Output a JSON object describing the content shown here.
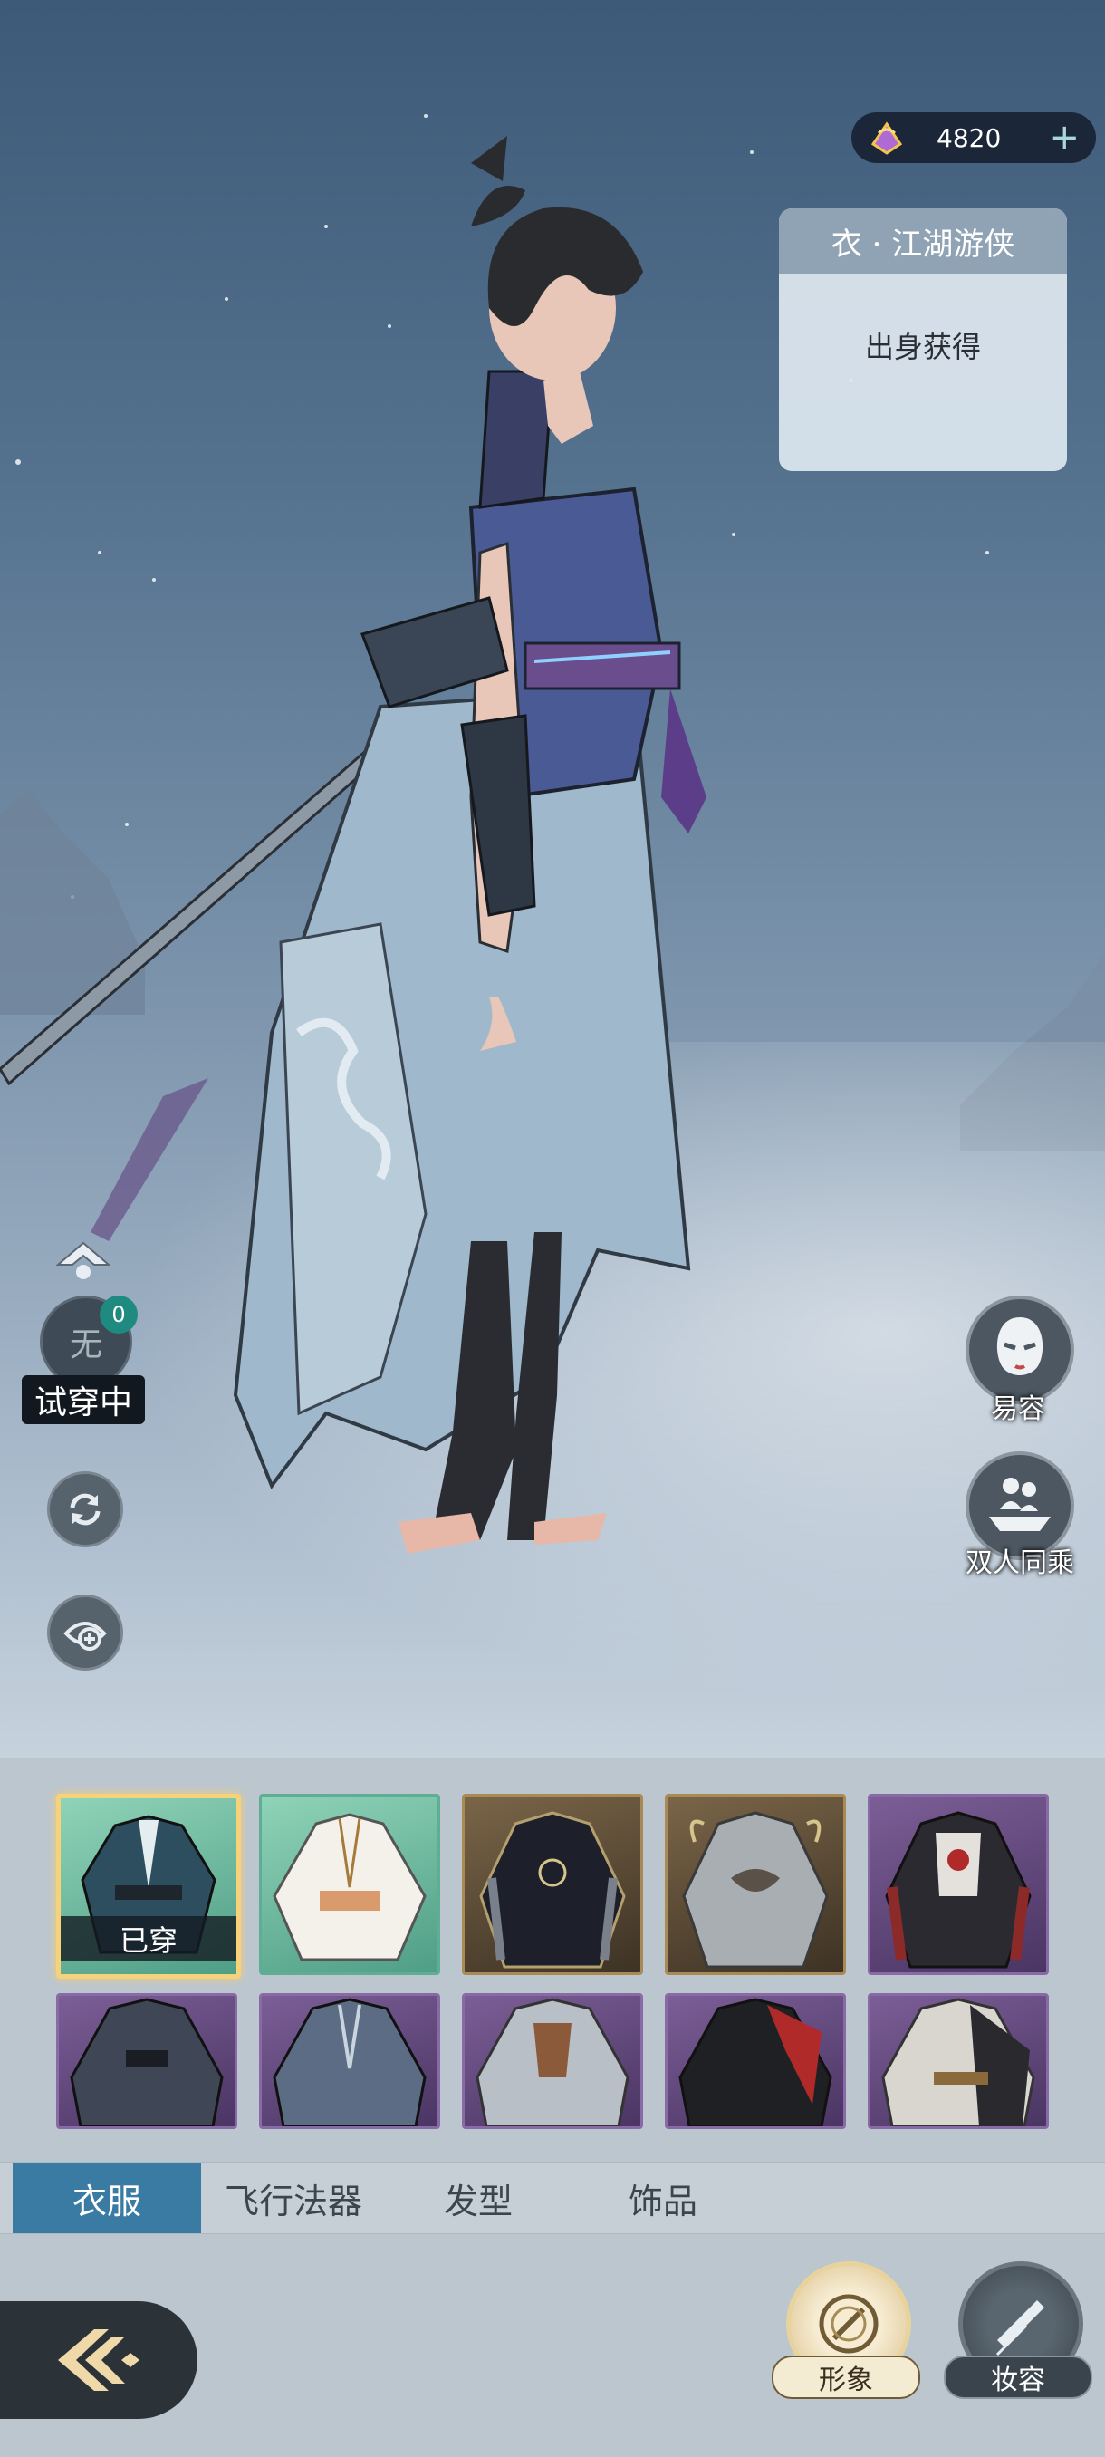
{
  "currency": {
    "amount": "4820",
    "plus_label": "+",
    "icon": "jade-gem-icon"
  },
  "item_info": {
    "title": "衣 · 江湖游侠",
    "source": "出身获得"
  },
  "trial": {
    "circle_text": "无",
    "badge_count": "0",
    "label": "试穿中"
  },
  "left_tools": {
    "rotate_icon": "rotate-icon",
    "zoom_icon": "zoom-in-icon",
    "arrow_icon": "up-arrow-icon"
  },
  "right_tools": {
    "face_label": "易容",
    "ride_label": "双人同乘"
  },
  "outfits": {
    "worn_label": "已穿",
    "items": [
      {
        "rarity": "green",
        "selected": true
      },
      {
        "rarity": "green",
        "selected": false
      },
      {
        "rarity": "gold",
        "selected": false
      },
      {
        "rarity": "gold",
        "selected": false
      },
      {
        "rarity": "purple",
        "selected": false
      },
      {
        "rarity": "purple",
        "selected": false
      },
      {
        "rarity": "purple",
        "selected": false
      },
      {
        "rarity": "purple",
        "selected": false
      },
      {
        "rarity": "purple",
        "selected": false
      },
      {
        "rarity": "purple",
        "selected": false
      }
    ]
  },
  "tabs": [
    {
      "label": "衣服",
      "active": true
    },
    {
      "label": "飞行法器",
      "active": false
    },
    {
      "label": "发型",
      "active": false
    },
    {
      "label": "饰品",
      "active": false
    }
  ],
  "bottom_actions": {
    "appearance_label": "形象",
    "makeup_label": "妆容"
  },
  "colors": {
    "accent": "#3a7ba3",
    "worn_border": "#f6d27a",
    "badge": "#1f8a7f"
  }
}
